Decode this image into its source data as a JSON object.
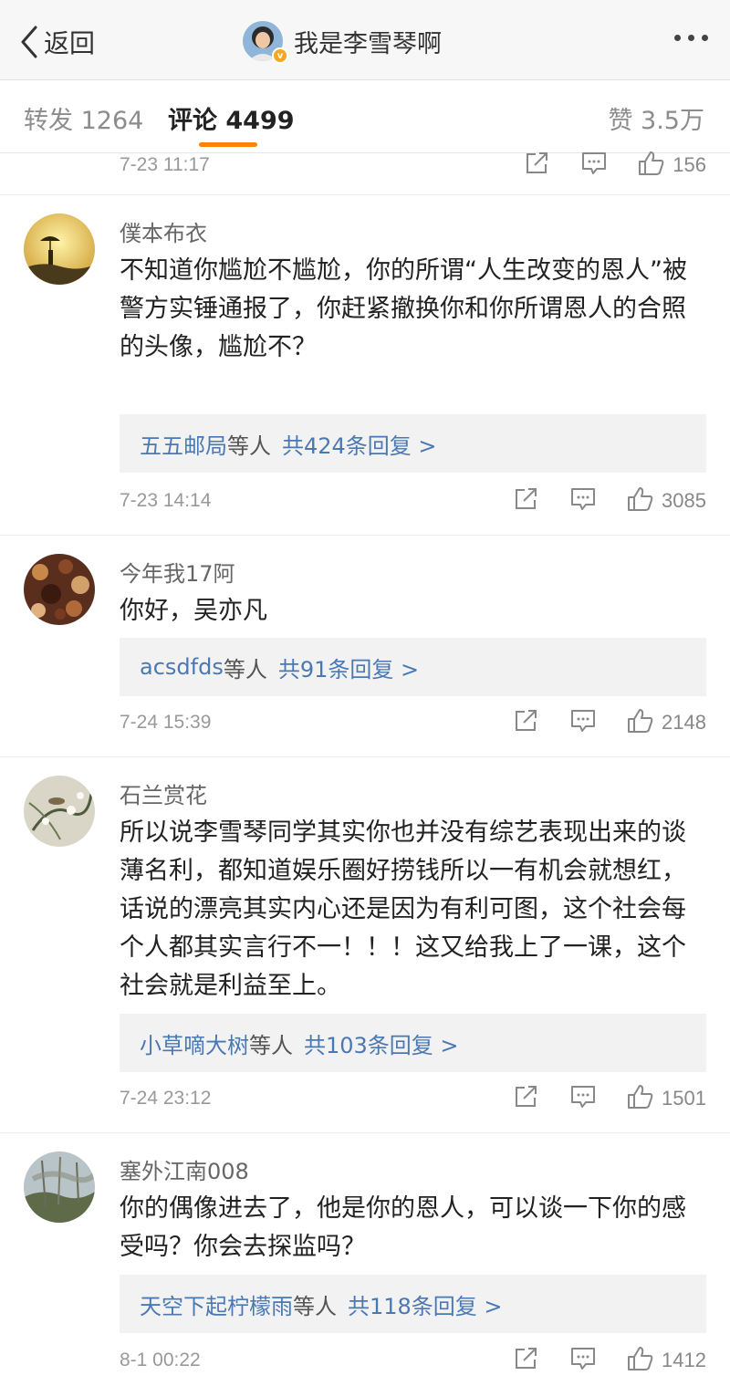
{
  "header": {
    "back_label": "返回",
    "title": "我是李雪琴啊",
    "verified_badge": "v"
  },
  "tabs": {
    "repost": "转发 1264",
    "comment": "评论 4499",
    "like": "赞 3.5万"
  },
  "top_meta": {
    "time": "7-23 11:17",
    "likes": "156"
  },
  "comments": [
    {
      "user": "僕本布衣",
      "text": "不知道你尴尬不尴尬，你的所谓“人生改变的恩人”被警方实锤通报了，你赶紧撤换你和你所谓恩人的合照的头像，尴尬不？",
      "reply_who": "五五邮局",
      "reply_etc": "等人",
      "reply_count": "共424条回复 >",
      "time": "7-23 14:14",
      "likes": "3085"
    },
    {
      "user": "今年我17阿",
      "text": "你好，吴亦凡",
      "reply_who": "acsdfds",
      "reply_etc": "等人",
      "reply_count": "共91条回复 >",
      "time": "7-24 15:39",
      "likes": "2148"
    },
    {
      "user": "石兰赏花",
      "text": "所以说李雪琴同学其实你也并没有综艺表现出来的谈薄名利，都知道娱乐圈好捞钱所以一有机会就想红，话说的漂亮其实内心还是因为有利可图，这个社会每个人都其实言行不一！！！这又给我上了一课，这个社会就是利益至上。",
      "reply_who": "小草嘀大树",
      "reply_etc": "等人",
      "reply_count": "共103条回复 >",
      "time": "7-24 23:12",
      "likes": "1501"
    },
    {
      "user": "塞外江南008",
      "text": "你的偶像进去了，他是你的恩人，可以谈一下你的感受吗？你会去探监吗？",
      "reply_who": "天空下起柠檬雨",
      "reply_etc": "等人",
      "reply_count": "共118条回复 >",
      "time": "8-1 00:22",
      "likes": "1412"
    }
  ],
  "icons": {
    "back": "chevron-left-icon",
    "more": "more-dots-icon",
    "share": "share-icon",
    "reply": "comment-icon",
    "like": "thumbs-up-icon"
  },
  "colors": {
    "accent": "#ff8200",
    "link": "#4a78b3",
    "badge": "#f5a623"
  }
}
